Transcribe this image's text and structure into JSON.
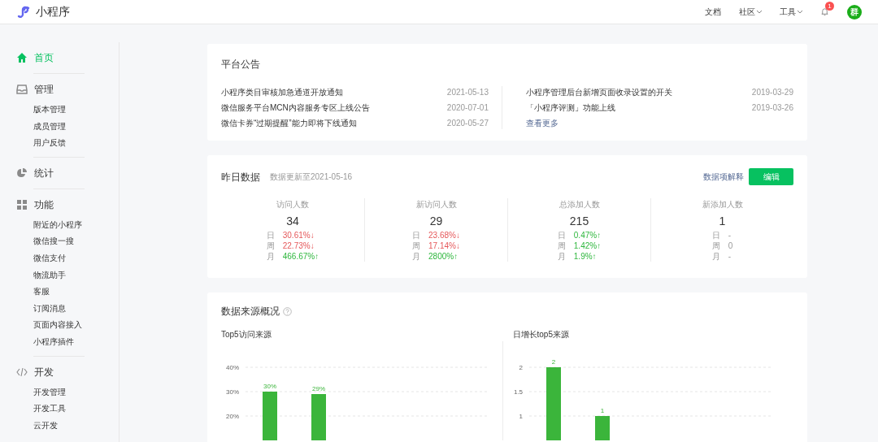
{
  "header": {
    "logo_text": "小程序",
    "nav": [
      {
        "label": "文档",
        "dropdown": false
      },
      {
        "label": "社区",
        "dropdown": true
      },
      {
        "label": "工具",
        "dropdown": true
      }
    ],
    "notification_count": "1",
    "avatar_text": "群"
  },
  "sidebar": {
    "sections": [
      {
        "kind": "home",
        "label": "首页",
        "selected": true
      },
      {
        "kind": "inbox",
        "label": "管理",
        "selected": false,
        "children": [
          {
            "label": "版本管理"
          },
          {
            "label": "成员管理"
          },
          {
            "label": "用户反馈"
          }
        ]
      },
      {
        "kind": "pie",
        "label": "统计",
        "selected": false
      },
      {
        "kind": "grid",
        "label": "功能",
        "selected": false,
        "children": [
          {
            "label": "附近的小程序"
          },
          {
            "label": "微信搜一搜"
          },
          {
            "label": "微信支付"
          },
          {
            "label": "物流助手"
          },
          {
            "label": "客服"
          },
          {
            "label": "订阅消息"
          },
          {
            "label": "页面内容接入"
          },
          {
            "label": "小程序插件"
          }
        ]
      },
      {
        "kind": "code",
        "label": "开发",
        "selected": false,
        "children": [
          {
            "label": "开发管理"
          },
          {
            "label": "开发工具"
          },
          {
            "label": "云开发"
          }
        ]
      }
    ]
  },
  "announcements": {
    "title": "平台公告",
    "left": [
      {
        "text": "小程序类目审核加急通道开放通知",
        "date": "2021-05-13"
      },
      {
        "text": "微信服务平台MCN内容服务专区上线公告",
        "date": "2020-07-01"
      },
      {
        "text": "微信卡券“过期提醒”能力即将下线通知",
        "date": "2020-05-27"
      }
    ],
    "right": [
      {
        "text": "小程序管理后台新增页面收录设置的开关",
        "date": "2019-03-29"
      },
      {
        "text": "「小程序评测」功能上线",
        "date": "2019-03-26"
      }
    ],
    "more_link": "查看更多"
  },
  "yesterday": {
    "title": "昨日数据",
    "updated": "数据更新至2021-05-16",
    "explain_link": "数据项解释",
    "edit_button": "编辑",
    "stats": [
      {
        "label": "访问人数",
        "value": "34",
        "changes": [
          {
            "period": "日",
            "value": "30.61%↓",
            "kind": "down"
          },
          {
            "period": "周",
            "value": "22.73%↓",
            "kind": "down"
          },
          {
            "period": "月",
            "value": "466.67%↑",
            "kind": "up"
          }
        ]
      },
      {
        "label": "新访问人数",
        "value": "29",
        "changes": [
          {
            "period": "日",
            "value": "23.68%↓",
            "kind": "down"
          },
          {
            "period": "周",
            "value": "17.14%↓",
            "kind": "down"
          },
          {
            "period": "月",
            "value": "2800%↑",
            "kind": "up"
          }
        ]
      },
      {
        "label": "总添加人数",
        "value": "215",
        "changes": [
          {
            "period": "日",
            "value": "0.47%↑",
            "kind": "up"
          },
          {
            "period": "周",
            "value": "1.42%↑",
            "kind": "up"
          },
          {
            "period": "月",
            "value": "1.9%↑",
            "kind": "up"
          }
        ]
      },
      {
        "label": "新添加人数",
        "value": "1",
        "changes": [
          {
            "period": "日",
            "value": "-",
            "kind": "none"
          },
          {
            "period": "周",
            "value": "0",
            "kind": "none"
          },
          {
            "period": "月",
            "value": "-",
            "kind": "none"
          }
        ]
      }
    ]
  },
  "sources": {
    "title": "数据来源概况",
    "charts": [
      {
        "subtitle": "Top5访问来源",
        "chart_data": {
          "type": "bar",
          "values": [
            30,
            29,
            null,
            null,
            null
          ],
          "ylim": [
            10,
            40
          ],
          "grid": true,
          "yticks": [
            {
              "value": 20,
              "label": "20%"
            },
            {
              "value": 30,
              "label": "30%"
            },
            {
              "value": 40,
              "label": "40%"
            }
          ],
          "data_labels": true,
          "value_labels": [
            "30%",
            "29%",
            null,
            null,
            null
          ]
        }
      },
      {
        "subtitle": "日增长top5来源",
        "chart_data": {
          "type": "bar",
          "values": [
            2,
            1,
            null,
            null,
            null
          ],
          "ylim": [
            0.5,
            2
          ],
          "grid": true,
          "yticks": [
            {
              "value": 1,
              "label": "1"
            },
            {
              "value": 1.5,
              "label": "1.5"
            },
            {
              "value": 2,
              "label": "2"
            }
          ],
          "data_labels": true,
          "value_labels": [
            "2",
            "1",
            null,
            null,
            null
          ]
        }
      }
    ]
  }
}
